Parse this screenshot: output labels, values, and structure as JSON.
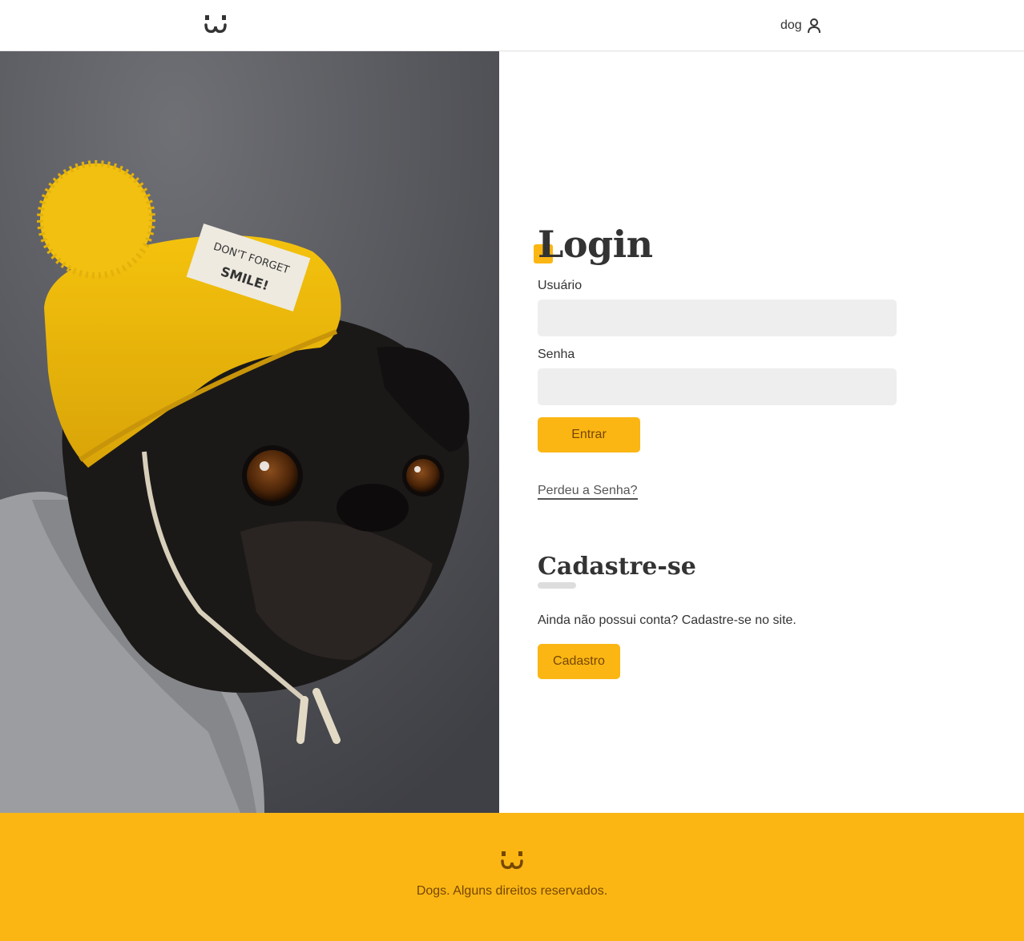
{
  "header": {
    "logo_icon": "dog-face-logo-icon",
    "login_label": "dog",
    "user_icon": "user-icon"
  },
  "photo": {
    "subject": "pug-in-yellow-beanie",
    "hat_label_line1": "DON'T FORGET",
    "hat_label_line2": "SMILE!"
  },
  "login": {
    "title": "Login",
    "username_label": "Usuário",
    "username_value": "",
    "password_label": "Senha",
    "password_value": "",
    "submit_label": "Entrar",
    "lost_password_label": "Perdeu a Senha?"
  },
  "signup": {
    "title": "Cadastre-se",
    "text": "Ainda não possui conta? Cadastre-se no site.",
    "button_label": "Cadastro"
  },
  "footer": {
    "logo_icon": "dog-face-logo-icon",
    "text": "Dogs. Alguns direitos reservados."
  },
  "colors": {
    "accent": "#fbb614",
    "accent_text": "#764701",
    "input_bg": "#eeeeee",
    "text": "#333333"
  }
}
